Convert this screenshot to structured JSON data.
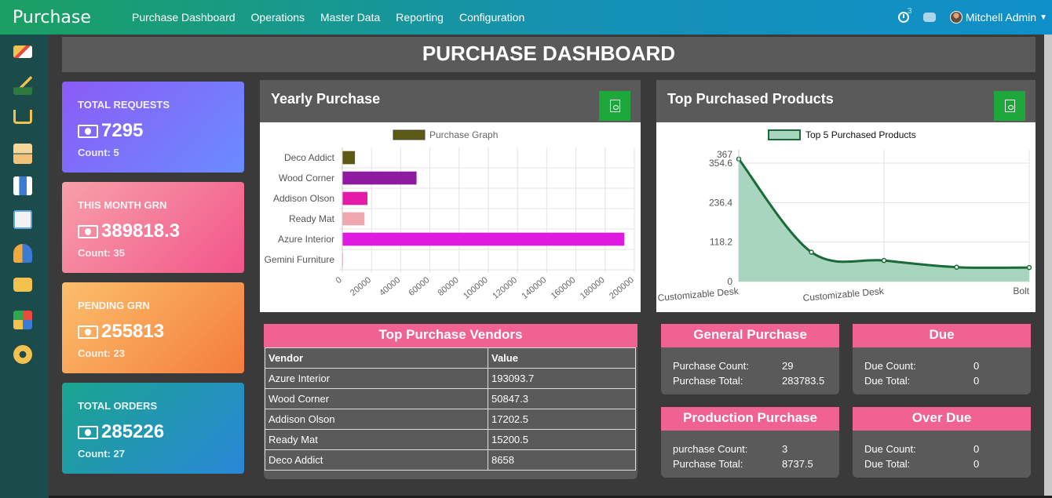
{
  "app": {
    "title": "Purchase"
  },
  "nav": [
    "Purchase Dashboard",
    "Operations",
    "Master Data",
    "Reporting",
    "Configuration"
  ],
  "topbar": {
    "activity_count": "3",
    "user_name": "Mitchell Admin"
  },
  "sidebar_icons": [
    "barrier-icon",
    "sales-chart-icon",
    "cart-icon",
    "boxes-icon",
    "worker-icon",
    "clipboard-calculator-icon",
    "people-icon",
    "taxi-icon",
    "apps-grid-icon",
    "settings-gear-icon"
  ],
  "dashboard": {
    "title": "PURCHASE DASHBOARD"
  },
  "stats": [
    {
      "label": "TOTAL REQUESTS",
      "value": "7295",
      "count": "Count: 5",
      "gradient": [
        "#8b5cf6",
        "#6a8cff"
      ]
    },
    {
      "label": "THIS MONTH GRN",
      "value": "389818.3",
      "count": "Count: 35",
      "gradient": [
        "#f7a0a9",
        "#f2558a"
      ]
    },
    {
      "label": "PENDING GRN",
      "value": "255813",
      "count": "Count: 23",
      "gradient": [
        "#fbbf6c",
        "#f47c3c"
      ]
    },
    {
      "label": "TOTAL ORDERS",
      "value": "285226",
      "count": "Count: 27",
      "gradient": [
        "#1aa58f",
        "#2a87d8"
      ]
    }
  ],
  "yearly": {
    "title": "Yearly Purchase"
  },
  "top_products": {
    "title": "Top Purchased Products"
  },
  "chart_data": [
    {
      "type": "bar",
      "orientation": "horizontal",
      "legend": "Purchase Graph",
      "series": [
        {
          "name": "Purchase Graph",
          "values": [
            8658,
            50847.3,
            17202.5,
            15200.5,
            193093.7,
            0
          ]
        }
      ],
      "categories": [
        "Deco Addict",
        "Wood Corner",
        "Addison Olson",
        "Ready Mat",
        "Azure Interior",
        "Gemini Furniture"
      ],
      "colors": [
        "#5a5a14",
        "#8e1aa0",
        "#e61aa8",
        "#f0a8b0",
        "#e01ae0",
        "#f0a8b0"
      ],
      "xlim": [
        0,
        200000
      ],
      "xticks": [
        0,
        20000,
        40000,
        60000,
        80000,
        100000,
        120000,
        140000,
        160000,
        180000,
        200000
      ],
      "legend_color": "#5a5a14"
    },
    {
      "type": "area",
      "legend": "Top 5 Purchased Products",
      "series": [
        {
          "name": "Top 5 Purchased Products",
          "values": [
            367,
            88,
            63,
            43,
            42
          ]
        }
      ],
      "x_labels": [
        "Customizable Desk",
        "Customizable Desk",
        "Bolt"
      ],
      "ylim": [
        0,
        394.6
      ],
      "yticks": [
        "0",
        "118.2",
        "236.4",
        "354.6"
      ],
      "ymax_label": "367",
      "line_color": "#1b6a3a",
      "fill_color": "#a8d5bd"
    }
  ],
  "vendors": {
    "title": "Top Purchase Vendors",
    "headers": [
      "Vendor",
      "Value"
    ],
    "rows": [
      [
        "Azure Interior",
        "193093.7"
      ],
      [
        "Wood Corner",
        "50847.3"
      ],
      [
        "Addison Olson",
        "17202.5"
      ],
      [
        "Ready Mat",
        "15200.5"
      ],
      [
        "Deco Addict",
        "8658"
      ]
    ]
  },
  "cards": [
    {
      "title": "General Purchase",
      "rows": [
        [
          "Purchase Count:",
          "29"
        ],
        [
          "Purchase Total:",
          "283783.5"
        ]
      ]
    },
    {
      "title": "Due",
      "rows": [
        [
          "Due Count:",
          "0"
        ],
        [
          "Due Total:",
          "0"
        ]
      ]
    },
    {
      "title": "Production Purchase",
      "rows": [
        [
          "purchase Count:",
          "3"
        ],
        [
          "Purchase Total:",
          "8737.5"
        ]
      ]
    },
    {
      "title": "Over Due",
      "rows": [
        [
          "Due Count:",
          "0"
        ],
        [
          "Due Total:",
          "0"
        ]
      ]
    }
  ]
}
